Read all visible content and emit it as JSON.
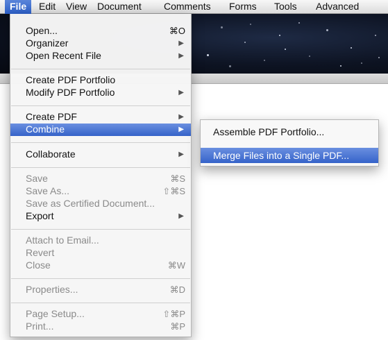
{
  "menubar": {
    "items": [
      {
        "label": "File",
        "active": true
      },
      {
        "label": "Edit"
      },
      {
        "label": "View"
      },
      {
        "label": "Document"
      },
      {
        "label": "Comments"
      },
      {
        "label": "Forms"
      },
      {
        "label": "Tools"
      },
      {
        "label": "Advanced"
      }
    ]
  },
  "file_menu": {
    "items": [
      {
        "label": "Open...",
        "shortcut": "⌘O",
        "enabled": true
      },
      {
        "label": "Organizer",
        "submenu": true,
        "enabled": true
      },
      {
        "label": "Open Recent File",
        "submenu": true,
        "enabled": true
      },
      {
        "label": "Create PDF Portfolio",
        "enabled": true
      },
      {
        "label": "Modify PDF Portfolio",
        "submenu": true,
        "enabled": true
      },
      {
        "label": "Create PDF",
        "submenu": true,
        "enabled": true
      },
      {
        "label": "Combine",
        "submenu": true,
        "enabled": true,
        "highlighted": true
      },
      {
        "label": "Collaborate",
        "submenu": true,
        "enabled": true
      },
      {
        "label": "Save",
        "shortcut": "⌘S",
        "enabled": false
      },
      {
        "label": "Save As...",
        "shortcut": "⇧⌘S",
        "enabled": false
      },
      {
        "label": "Save as Certified Document...",
        "enabled": false
      },
      {
        "label": "Export",
        "submenu": true,
        "enabled": true
      },
      {
        "label": "Attach to Email...",
        "enabled": false
      },
      {
        "label": "Revert",
        "enabled": false
      },
      {
        "label": "Close",
        "shortcut": "⌘W",
        "enabled": false
      },
      {
        "label": "Properties...",
        "shortcut": "⌘D",
        "enabled": false
      },
      {
        "label": "Page Setup...",
        "shortcut": "⇧⌘P",
        "enabled": false
      },
      {
        "label": "Print...",
        "shortcut": "⌘P",
        "enabled": false
      }
    ],
    "submenu_arrow": "▶"
  },
  "combine_submenu": {
    "items": [
      {
        "label": "Assemble PDF Portfolio..."
      },
      {
        "label": "Merge Files into a Single PDF...",
        "highlighted": true
      }
    ]
  },
  "colors": {
    "highlight": "#3563c9",
    "disabled_text": "#8a8a8a",
    "menu_bg": "#f6f6f6"
  }
}
